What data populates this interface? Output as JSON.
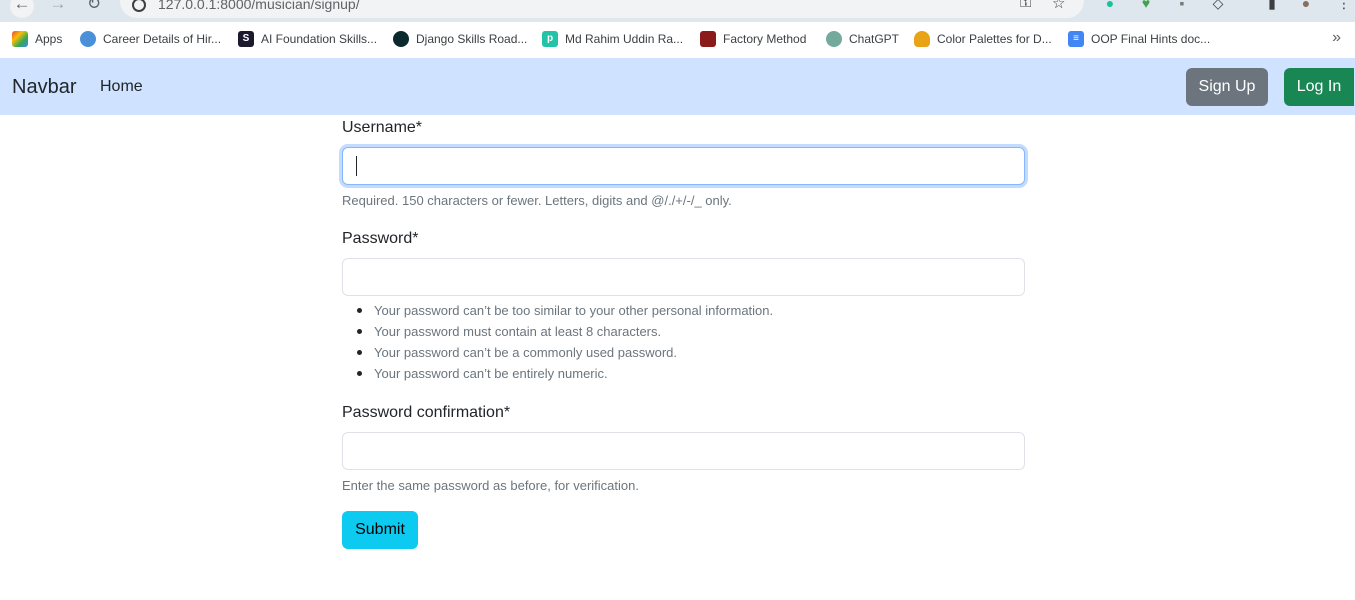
{
  "browser": {
    "url": "127.0.0.1:8000/musician/signup/",
    "bookmarks": [
      {
        "label": "Apps",
        "icon": "apps-grid-icon",
        "color": "#4285f4"
      },
      {
        "label": "Career Details of Hir...",
        "icon": "career-icon",
        "color": "#4a90d9"
      },
      {
        "label": "AI Foundation Skills...",
        "icon": "s-logo-icon",
        "color": "#1a1a2e"
      },
      {
        "label": "Django Skills Road...",
        "icon": "django-icon",
        "color": "#0c2a2e"
      },
      {
        "label": "Md Rahim Uddin Ra...",
        "icon": "p-logo-icon",
        "color": "#22c3a6"
      },
      {
        "label": "Factory Method",
        "icon": "factory-icon",
        "color": "#8b1a1a"
      },
      {
        "label": "ChatGPT",
        "icon": "chatgpt-icon",
        "color": "#74aa9c"
      },
      {
        "label": "Color Palettes for D...",
        "icon": "palette-icon",
        "color": "#e8a317"
      },
      {
        "label": "OOP Final Hints doc...",
        "icon": "docs-icon",
        "color": "#4285f4"
      }
    ],
    "more_label": "»"
  },
  "navbar": {
    "brand": "Navbar",
    "home": "Home",
    "signup": "Sign Up",
    "login": "Log In",
    "colors": {
      "bg": "#cfe2ff",
      "signup": "#6c757d",
      "login": "#198754"
    }
  },
  "form": {
    "username_label": "Username*",
    "username_value": "",
    "username_help": "Required. 150 characters or fewer. Letters, digits and @/./+/-/_ only.",
    "password_label": "Password*",
    "password_value": "",
    "password_hints": [
      "Your password can’t be too similar to your other personal information.",
      "Your password must contain at least 8 characters.",
      "Your password can’t be a commonly used password.",
      "Your password can’t be entirely numeric."
    ],
    "confirm_label": "Password confirmation*",
    "confirm_value": "",
    "confirm_help": "Enter the same password as before, for verification.",
    "submit": "Submit",
    "submit_color": "#0dcaf0"
  }
}
